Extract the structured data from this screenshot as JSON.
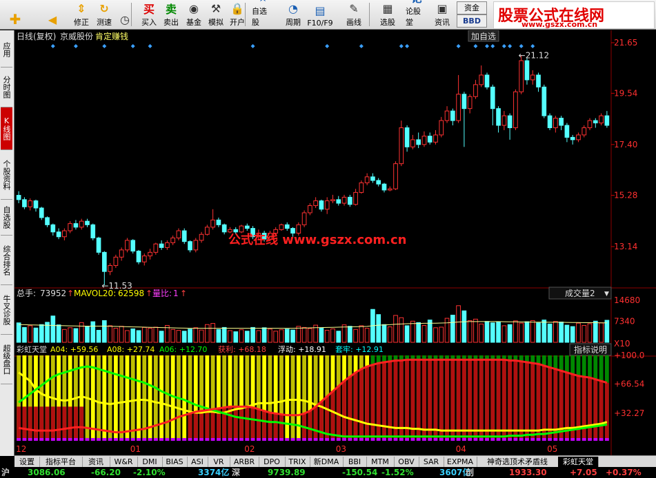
{
  "toolbar": {
    "buttons": [
      {
        "id": "back",
        "label": "",
        "icon": "back-arrow-icon"
      },
      {
        "id": "fix",
        "label": "修正",
        "icon": "up-down-arrow-icon"
      },
      {
        "id": "test",
        "label": "测速",
        "icon": "refresh-icon"
      },
      {
        "id": "speed",
        "label": "",
        "icon": "clock-icon"
      },
      {
        "id": "buy",
        "label": "买入",
        "icon": "buy-icon",
        "glyph": "买"
      },
      {
        "id": "sell",
        "label": "卖出",
        "icon": "sell-icon",
        "glyph": "卖"
      },
      {
        "id": "fund",
        "label": "基金",
        "icon": "fund-icon"
      },
      {
        "id": "sim",
        "label": "模拟",
        "icon": "hammer-icon"
      },
      {
        "id": "open",
        "label": "开户",
        "icon": "lock-icon"
      },
      {
        "id": "watch",
        "label": "自选股",
        "icon": "star-icon"
      },
      {
        "id": "period",
        "label": "周期",
        "icon": "period-icon"
      },
      {
        "id": "f10",
        "label": "F10/F9",
        "icon": "f10-icon"
      },
      {
        "id": "draw",
        "label": "画线",
        "icon": "pencil-icon"
      },
      {
        "id": "pick",
        "label": "选股",
        "icon": "grid-icon"
      },
      {
        "id": "forum",
        "label": "论股堂",
        "icon": "forum-icon",
        "glyph": "论"
      },
      {
        "id": "news",
        "label": "资讯",
        "icon": "news-icon"
      }
    ],
    "fund_btn": "资金",
    "bbd_btn": "BBD"
  },
  "brand": {
    "title": "股票公式在线网",
    "url": "www.gszx.com.cn"
  },
  "sidebar": [
    "应用",
    "分时图",
    "K线图",
    "个股资料",
    "自选股",
    "综合排名",
    "牛叉诊股",
    "超级盘口"
  ],
  "sidebar_active": 2,
  "header": {
    "title": "日线(复权)",
    "stock": "京威股份",
    "indicator": "肯定赚钱",
    "add": "加自选"
  },
  "watermark": "公式在线 www.gszx.com.cn",
  "price_axis": [
    "21.65",
    "19.54",
    "17.40",
    "15.28",
    "13.14"
  ],
  "price_labels": {
    "max": "21.12",
    "min": "11.53"
  },
  "volume_header": {
    "total_label": "总手:",
    "total_value": "73952",
    "mavol_label": "MAVOL20:",
    "mavol_value": "62598",
    "ratio_label": "量比:",
    "ratio_value": "1"
  },
  "volume_selector": "成交量2",
  "volume_axis": [
    "14680",
    "7340",
    "X10"
  ],
  "indicator_header": {
    "name": "彩虹天堂",
    "a04": "A04: +59.56",
    "a08": "A08: +27.74",
    "a06": "A06: +12.70",
    "profit": "获利: +68.18",
    "float": "浮动: +18.91",
    "trap": "套牢: +12.91"
  },
  "indicator_help": "指标说明",
  "indicator_axis": [
    "+100.0",
    "+66.54",
    "+32.27"
  ],
  "month_labels": [
    "12",
    "01",
    "02",
    "03",
    "04",
    "05"
  ],
  "bottom_tabs": [
    "设置",
    "指标平台",
    "资讯",
    "W&R",
    "DMI",
    "BIAS",
    "ASI",
    "VR",
    "ARBR",
    "DPO",
    "TRIX",
    "新DMA",
    "BBI",
    "MTM",
    "OBV",
    "SAR",
    "EXPMA",
    "神奇选顶术矛盾线",
    "彩虹天堂"
  ],
  "bottom_active": 18,
  "ticker": [
    {
      "t": "沪",
      "c": "#ccc"
    },
    {
      "t": "3086.06",
      "c": "#30e030"
    },
    {
      "t": "-66.20",
      "c": "#30e030"
    },
    {
      "t": "-2.10%",
      "c": "#30e030"
    },
    {
      "t": "3374亿",
      "c": "#3ad0ff"
    },
    {
      "t": "深",
      "c": "#ccc"
    },
    {
      "t": "9739.89",
      "c": "#30e030"
    },
    {
      "t": "-150.54",
      "c": "#30e030"
    },
    {
      "t": "-1.52%",
      "c": "#30e030"
    },
    {
      "t": "3607亿",
      "c": "#3ad0ff"
    },
    {
      "t": "创",
      "c": "#ccc"
    },
    {
      "t": "1933.30",
      "c": "#ff4040"
    },
    {
      "t": "+7.05",
      "c": "#ff4040"
    },
    {
      "t": "+0.37%",
      "c": "#ff4040"
    }
  ],
  "colors": {
    "up": "#ff3232",
    "down": "#54ffff",
    "yellow": "#ffff00",
    "green": "#00ff00",
    "red": "#ff2020",
    "purple": "#c000ff",
    "dim_green": "#004400"
  },
  "chart_data": {
    "type": "candlestick",
    "price_range": [
      11.53,
      21.65
    ],
    "candles": [
      [
        15.28,
        15.1,
        15.45,
        14.95
      ],
      [
        15.1,
        14.8,
        15.2,
        14.7
      ],
      [
        14.8,
        15.05,
        15.15,
        14.65
      ],
      [
        15.05,
        14.75,
        15.1,
        14.6
      ],
      [
        14.75,
        14.35,
        14.8,
        14.25
      ],
      [
        14.35,
        14.05,
        14.4,
        13.95
      ],
      [
        14.05,
        13.75,
        14.1,
        13.6
      ],
      [
        13.75,
        13.55,
        13.9,
        13.45
      ],
      [
        13.55,
        13.8,
        13.9,
        13.4
      ],
      [
        13.8,
        14.1,
        14.2,
        13.7
      ],
      [
        14.1,
        13.95,
        14.25,
        13.85
      ],
      [
        13.95,
        14.2,
        14.3,
        13.85
      ],
      [
        14.2,
        14.05,
        14.3,
        13.95
      ],
      [
        14.05,
        13.5,
        14.1,
        13.4
      ],
      [
        13.5,
        12.9,
        13.55,
        12.8
      ],
      [
        12.9,
        12.1,
        12.95,
        11.53
      ],
      [
        12.1,
        12.35,
        12.45,
        11.95
      ],
      [
        12.35,
        12.7,
        12.8,
        12.25
      ],
      [
        12.7,
        13.0,
        13.1,
        12.55
      ],
      [
        13.0,
        13.4,
        13.5,
        12.9
      ],
      [
        13.4,
        12.95,
        13.45,
        12.85
      ],
      [
        12.95,
        12.5,
        13.0,
        12.4
      ],
      [
        12.5,
        12.75,
        12.85,
        12.35
      ],
      [
        12.75,
        12.9,
        13.05,
        12.6
      ],
      [
        12.9,
        13.25,
        13.3,
        12.8
      ],
      [
        13.25,
        13.1,
        13.4,
        13.0
      ],
      [
        13.1,
        13.3,
        13.4,
        13.0
      ],
      [
        13.3,
        13.5,
        13.6,
        13.2
      ],
      [
        13.5,
        13.8,
        13.9,
        13.4
      ],
      [
        13.8,
        13.35,
        13.9,
        13.25
      ],
      [
        13.35,
        13.0,
        13.4,
        12.9
      ],
      [
        13.0,
        13.4,
        13.5,
        12.9
      ],
      [
        13.4,
        13.65,
        13.75,
        13.3
      ],
      [
        13.65,
        13.95,
        14.05,
        13.6
      ],
      [
        13.95,
        14.25,
        14.7,
        13.85
      ],
      [
        14.25,
        14.05,
        14.35,
        13.95
      ],
      [
        14.05,
        13.75,
        14.1,
        13.65
      ],
      [
        13.75,
        13.85,
        13.95,
        13.7
      ],
      [
        13.85,
        13.75,
        13.95,
        13.65
      ],
      [
        13.75,
        14.0,
        14.05,
        13.7
      ],
      [
        14.0,
        13.9,
        14.1,
        13.8
      ],
      [
        13.9,
        13.55,
        14.0,
        13.45
      ],
      [
        13.55,
        13.7,
        13.85,
        13.45
      ],
      [
        13.7,
        13.45,
        13.8,
        13.35
      ],
      [
        13.45,
        13.7,
        13.8,
        13.4
      ],
      [
        13.7,
        13.85,
        13.95,
        13.6
      ],
      [
        13.85,
        14.05,
        14.1,
        13.8
      ],
      [
        14.05,
        13.9,
        14.15,
        13.8
      ],
      [
        13.9,
        13.7,
        13.95,
        13.55
      ],
      [
        13.7,
        14.05,
        14.15,
        13.6
      ],
      [
        14.05,
        14.55,
        14.65,
        13.95
      ],
      [
        14.55,
        14.85,
        14.95,
        14.45
      ],
      [
        14.85,
        15.05,
        15.2,
        14.75
      ],
      [
        15.05,
        14.7,
        15.1,
        14.6
      ],
      [
        14.7,
        15.05,
        15.2,
        14.5
      ],
      [
        15.05,
        15.1,
        15.3,
        14.95
      ],
      [
        15.1,
        14.95,
        15.25,
        14.85
      ],
      [
        14.95,
        15.2,
        15.3,
        14.85
      ],
      [
        15.2,
        14.9,
        15.3,
        14.8
      ],
      [
        14.9,
        15.4,
        15.55,
        14.85
      ],
      [
        15.4,
        15.8,
        15.9,
        15.35
      ],
      [
        15.8,
        16.05,
        16.2,
        15.7
      ],
      [
        16.05,
        15.9,
        16.2,
        15.8
      ],
      [
        15.9,
        15.75,
        16.0,
        15.65
      ],
      [
        15.75,
        15.5,
        15.8,
        15.4
      ],
      [
        15.5,
        15.55,
        15.65,
        15.45
      ],
      [
        15.55,
        16.6,
        16.7,
        15.5
      ],
      [
        16.6,
        18.1,
        18.4,
        16.5
      ],
      [
        18.1,
        17.3,
        18.2,
        17.1
      ],
      [
        17.3,
        17.6,
        17.8,
        17.2
      ],
      [
        17.6,
        17.4,
        17.9,
        17.25
      ],
      [
        17.4,
        17.75,
        17.95,
        17.3
      ],
      [
        17.75,
        17.5,
        17.9,
        17.4
      ],
      [
        17.5,
        17.8,
        18.0,
        17.4
      ],
      [
        17.8,
        18.4,
        18.55,
        17.7
      ],
      [
        18.4,
        18.8,
        19.0,
        18.3
      ],
      [
        18.8,
        18.4,
        18.9,
        18.2
      ],
      [
        18.4,
        19.5,
        20.3,
        18.3
      ],
      [
        19.5,
        18.9,
        19.6,
        17.3
      ],
      [
        18.9,
        19.4,
        19.5,
        18.7
      ],
      [
        19.4,
        19.9,
        20.1,
        19.3
      ],
      [
        19.9,
        20.3,
        20.7,
        19.8
      ],
      [
        20.3,
        19.8,
        20.4,
        19.7
      ],
      [
        19.8,
        18.9,
        19.9,
        18.2
      ],
      [
        18.9,
        18.2,
        19.0,
        17.9
      ],
      [
        18.2,
        18.6,
        18.8,
        18.0
      ],
      [
        18.6,
        18.1,
        18.7,
        17.6
      ],
      [
        18.1,
        19.6,
        19.7,
        18.0
      ],
      [
        19.6,
        20.9,
        21.12,
        19.5
      ],
      [
        20.9,
        20.1,
        21.0,
        19.9
      ],
      [
        20.1,
        20.3,
        20.5,
        19.9
      ],
      [
        20.3,
        19.8,
        20.4,
        19.6
      ],
      [
        19.8,
        18.6,
        19.9,
        18.5
      ],
      [
        18.6,
        18.1,
        18.7,
        18.0
      ],
      [
        18.1,
        18.5,
        18.6,
        17.9
      ],
      [
        18.5,
        18.2,
        18.6,
        18.0
      ],
      [
        18.2,
        17.7,
        18.3,
        17.5
      ],
      [
        17.7,
        17.6,
        17.8,
        17.4
      ],
      [
        17.6,
        17.8,
        17.9,
        17.5
      ],
      [
        17.8,
        18.1,
        18.2,
        17.7
      ],
      [
        18.1,
        18.4,
        18.5,
        18.0
      ],
      [
        18.4,
        18.3,
        18.5,
        18.1
      ],
      [
        18.3,
        18.6,
        18.7,
        18.2
      ],
      [
        18.6,
        18.2,
        18.8,
        18.1
      ]
    ],
    "volume_range": [
      0,
      14680
    ],
    "volume": [
      6800,
      5200,
      5800,
      5000,
      6200,
      7000,
      9200,
      6100,
      4500,
      5100,
      4800,
      6900,
      5600,
      7200,
      4200,
      7600,
      5800,
      4900,
      5600,
      4100,
      4700,
      4100,
      5200,
      4900,
      5300,
      3900,
      5900,
      4500,
      4200,
      3900,
      4600,
      5100,
      4300,
      6200,
      6600,
      4500,
      5200,
      4100,
      3700,
      4400,
      3900,
      5200,
      4100,
      5100,
      4600,
      3900,
      4400,
      4600,
      4300,
      5600,
      5200,
      4800,
      6000,
      5000,
      4200,
      4700,
      3900,
      6100,
      5600,
      4500,
      5800,
      4900,
      11500,
      9700,
      6200,
      5400,
      9400,
      8600,
      5800,
      7400,
      6900,
      5900,
      7800,
      5100,
      5300,
      8400,
      9500,
      12800,
      11000,
      7600,
      8100,
      6400,
      7300,
      6800,
      7100,
      5800,
      6200,
      7500,
      6700,
      7200,
      7600,
      6800,
      7800,
      6400,
      7300,
      7100,
      6000,
      5500,
      6700,
      5900,
      6500,
      7400,
      6800,
      7700
    ],
    "mavol": [
      6200,
      6150,
      6100,
      6050,
      6000,
      5950,
      5900,
      5850,
      5800,
      5750,
      5700,
      5650,
      5650,
      5650,
      5650,
      5650,
      5600,
      5550,
      5500,
      5450,
      5400,
      5350,
      5300,
      5250,
      5200,
      5150,
      5100,
      5050,
      5000,
      4950,
      4900,
      4900,
      4900,
      4900,
      4900,
      4900,
      4900,
      4900,
      4900,
      4900,
      4900,
      4900,
      4900,
      4900,
      4900,
      4900,
      4900,
      4900,
      4900,
      4950,
      5000,
      5050,
      5100,
      5150,
      5200,
      5250,
      5300,
      5350,
      5400,
      5450,
      5500,
      5550,
      5800,
      6000,
      6100,
      6150,
      6300,
      6400,
      6500,
      6550,
      6600,
      6650,
      6700,
      6700,
      6750,
      6800,
      6950,
      7100,
      7200,
      7250,
      7250,
      7250,
      7250,
      7250,
      7250,
      7200,
      7150,
      7150,
      7100,
      7100,
      7050,
      7050,
      7050,
      7000,
      7000,
      7000,
      6950,
      6900,
      6900,
      6850,
      6850,
      6850,
      6800,
      6800
    ],
    "indicator_range": [
      0,
      100
    ],
    "series": [
      {
        "name": "A04",
        "color": "#ffff00",
        "values": [
          80,
          75,
          70,
          60,
          55,
          52,
          50,
          48,
          47,
          48,
          50,
          52,
          50,
          48,
          45,
          44,
          43,
          44,
          45,
          46,
          47,
          48,
          48,
          47,
          45,
          44,
          42,
          40,
          38,
          36,
          34,
          33,
          33,
          34,
          34,
          33,
          33,
          35,
          37,
          38,
          40,
          42,
          44,
          44,
          44,
          45,
          46,
          48,
          48,
          48,
          47,
          45,
          42,
          40,
          37,
          34,
          31,
          28,
          26,
          24,
          22,
          20,
          19,
          18,
          17,
          16,
          15,
          15,
          15,
          14,
          14,
          13,
          13,
          13,
          12,
          12,
          12,
          12,
          12,
          12,
          12,
          12,
          12,
          12,
          12,
          12,
          12,
          12,
          12,
          12,
          12,
          12,
          13,
          13,
          13,
          14,
          15,
          15,
          16,
          17,
          18,
          19,
          20,
          22
        ]
      },
      {
        "name": "A06",
        "color": "#00ff00",
        "values": [
          45,
          50,
          55,
          60,
          65,
          70,
          75,
          78,
          80,
          82,
          84,
          86,
          87,
          86,
          84,
          82,
          80,
          78,
          76,
          74,
          72,
          70,
          68,
          65,
          62,
          58,
          55,
          52,
          50,
          48,
          45,
          42,
          40,
          38,
          36,
          34,
          32,
          30,
          28,
          27,
          26,
          25,
          24,
          23,
          22,
          22,
          21,
          20,
          19,
          18,
          16,
          14,
          12,
          10,
          8,
          7,
          6,
          5,
          5,
          5,
          5,
          5,
          5,
          5,
          5,
          5,
          5,
          5,
          5,
          5,
          5,
          5,
          5,
          5,
          5,
          5,
          5,
          5,
          5,
          5,
          5,
          5,
          5,
          5,
          5,
          5,
          6,
          6,
          6,
          7,
          7,
          8,
          8,
          9,
          10,
          11,
          12,
          13,
          14,
          15,
          16,
          17,
          18,
          19
        ]
      },
      {
        "name": "获利",
        "color": "#ff2020",
        "values": [
          15,
          14,
          13,
          12,
          12,
          12,
          12,
          13,
          14,
          15,
          16,
          16,
          15,
          14,
          13,
          12,
          11,
          10,
          10,
          11,
          12,
          13,
          14,
          16,
          18,
          20,
          22,
          25,
          28,
          30,
          32,
          34,
          35,
          36,
          37,
          38,
          39,
          40,
          40,
          40,
          40,
          39,
          37,
          35,
          33,
          32,
          31,
          30,
          30,
          30,
          32,
          35,
          40,
          46,
          52,
          58,
          64,
          70,
          75,
          80,
          84,
          87,
          89,
          91,
          92,
          93,
          94,
          94,
          95,
          95,
          95,
          95,
          95,
          95,
          95,
          95,
          95,
          95,
          95,
          95,
          95,
          95,
          95,
          95,
          95,
          95,
          94,
          94,
          93,
          92,
          91,
          90,
          88,
          86,
          84,
          82,
          80,
          78,
          76,
          75,
          74,
          72,
          70,
          68
        ]
      }
    ],
    "month_ticks": [
      {
        "label": "12",
        "index": 0
      },
      {
        "label": "01",
        "index": 20
      },
      {
        "label": "02",
        "index": 40
      },
      {
        "label": "03",
        "index": 56
      },
      {
        "label": "04",
        "index": 77
      },
      {
        "label": "05",
        "index": 93
      }
    ],
    "markers": [
      6,
      10,
      15,
      20,
      23,
      41,
      54,
      60,
      67,
      68,
      77,
      80,
      82,
      83,
      85,
      86,
      88,
      90
    ]
  }
}
